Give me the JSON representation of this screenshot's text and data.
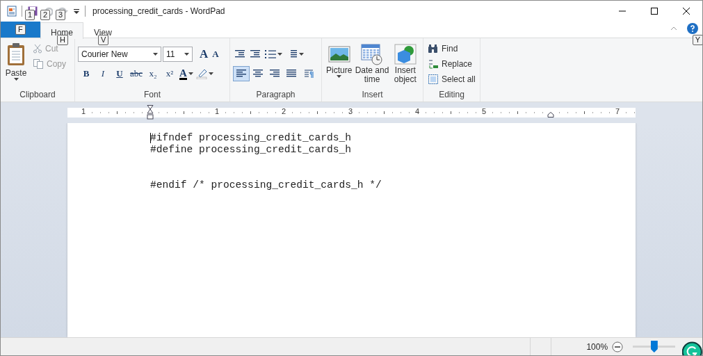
{
  "window": {
    "title": "processing_credit_cards - WordPad"
  },
  "quick_access": {
    "keytips": [
      "1",
      "2",
      "3"
    ]
  },
  "file_tab": {
    "keytip": "F"
  },
  "tabs": [
    {
      "label": "Home",
      "keytip": "H",
      "selected": true
    },
    {
      "label": "View",
      "keytip": "V",
      "selected": false
    }
  ],
  "help": {
    "keytip": "Y"
  },
  "clipboard": {
    "group": "Clipboard",
    "paste": "Paste",
    "items": [
      {
        "kind": "cut",
        "label": "Cut",
        "disabled": true
      },
      {
        "kind": "copy",
        "label": "Copy",
        "disabled": true
      }
    ]
  },
  "font": {
    "group": "Font",
    "family": "Courier New",
    "size": "11",
    "grow": "A",
    "shrink": "A",
    "format_buttons": [
      {
        "kind": "bold",
        "label": "B"
      },
      {
        "kind": "italic",
        "label": "I"
      },
      {
        "kind": "underline",
        "label": "U"
      },
      {
        "kind": "strike",
        "label": "abc"
      },
      {
        "kind": "sub",
        "label": "x₂"
      },
      {
        "kind": "sup",
        "label": "x²"
      }
    ],
    "color_letter": "A"
  },
  "paragraph": {
    "group": "Paragraph",
    "alignments": [
      {
        "kind": "left",
        "selected": true
      },
      {
        "kind": "center",
        "selected": false
      },
      {
        "kind": "right",
        "selected": false
      },
      {
        "kind": "justify",
        "selected": false
      }
    ]
  },
  "insert": {
    "group": "Insert",
    "buttons": [
      {
        "kind": "picture",
        "label": "Picture"
      },
      {
        "kind": "datetime",
        "label": "Date and time"
      },
      {
        "kind": "object",
        "label": "Insert object"
      }
    ]
  },
  "editing": {
    "group": "Editing",
    "items": [
      {
        "kind": "find",
        "label": "Find"
      },
      {
        "kind": "replace",
        "label": "Replace"
      },
      {
        "kind": "select",
        "label": "Select all"
      }
    ]
  },
  "ruler": {
    "numbers": [
      "1",
      "1",
      "2",
      "3",
      "4",
      "5",
      "7"
    ]
  },
  "document": {
    "lines": [
      {
        "kind": "code",
        "text": "#ifndef processing_credit_cards_h"
      },
      {
        "kind": "code",
        "text": "#define processing_credit_cards_h"
      },
      {
        "kind": "blank"
      },
      {
        "kind": "blank"
      },
      {
        "kind": "code",
        "text": "#endif /* processing_credit_cards_h */"
      }
    ]
  },
  "status_bar": {
    "zoom": "100%",
    "zoom_slider": {
      "level": 0.5
    }
  }
}
